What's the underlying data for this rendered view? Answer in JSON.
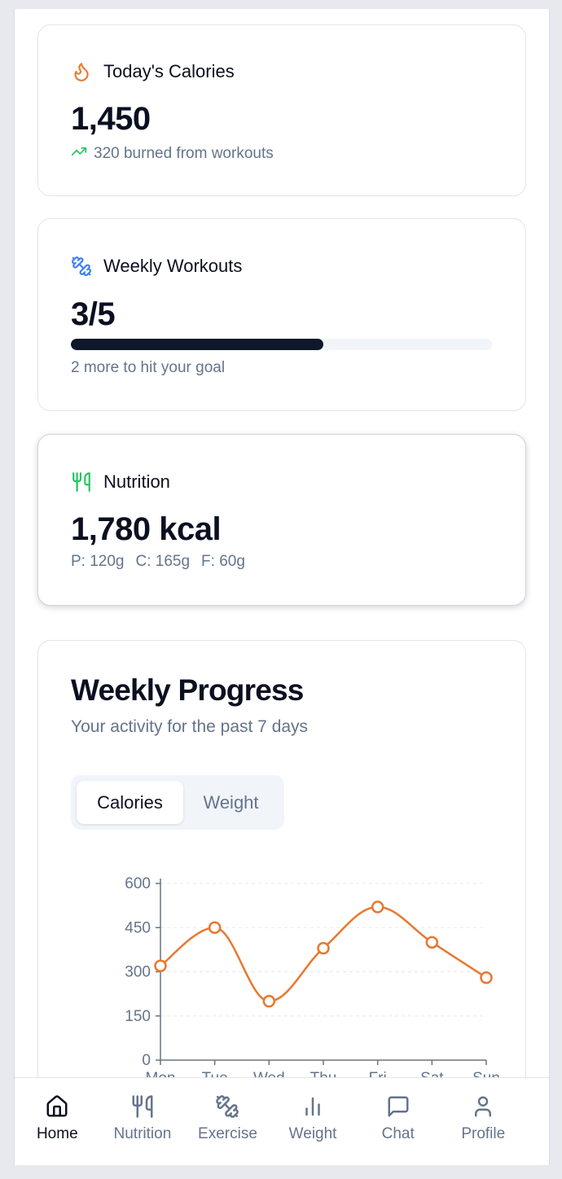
{
  "cards": {
    "calories": {
      "title": "Today's Calories",
      "value": "1,450",
      "subtext": "320 burned from workouts",
      "icon": "flame-icon",
      "icon_color": "#ea7a2e"
    },
    "workouts": {
      "title": "Weekly Workouts",
      "value": "3/5",
      "subtext": "2 more to hit your goal",
      "progress": 0.6,
      "icon": "dumbbell-icon",
      "icon_color": "#3b82f6"
    },
    "nutrition": {
      "title": "Nutrition",
      "value": "1,780 kcal",
      "macros": {
        "protein": "P: 120g",
        "carbs": "C: 165g",
        "fat": "F: 60g"
      },
      "icon": "utensils-icon",
      "icon_color": "#22c55e"
    }
  },
  "progress": {
    "title": "Weekly Progress",
    "subtitle": "Your activity for the past 7 days",
    "tabs": [
      "Calories",
      "Weight"
    ],
    "active_tab": "Calories"
  },
  "chart_data": {
    "type": "line",
    "categories": [
      "Mon",
      "Tue",
      "Wed",
      "Thu",
      "Fri",
      "Sat",
      "Sun"
    ],
    "values": [
      320,
      450,
      200,
      380,
      520,
      400,
      280
    ],
    "ylim": [
      0,
      600
    ],
    "yticks": [
      "0",
      "150",
      "300",
      "450",
      "600"
    ],
    "ytick_values": [
      0,
      150,
      300,
      450,
      600
    ],
    "grid": "horizontal dashed",
    "color": "#e8782f"
  },
  "nav": {
    "items": [
      {
        "label": "Home",
        "icon": "home-icon",
        "active": true
      },
      {
        "label": "Nutrition",
        "icon": "utensils-icon",
        "active": false
      },
      {
        "label": "Exercise",
        "icon": "dumbbell-icon",
        "active": false
      },
      {
        "label": "Weight",
        "icon": "bar-chart-icon",
        "active": false
      },
      {
        "label": "Chat",
        "icon": "message-icon",
        "active": false
      },
      {
        "label": "Profile",
        "icon": "user-icon",
        "active": false
      }
    ]
  },
  "colors": {
    "text_primary": "#0b1020",
    "text_muted": "#64748b",
    "trend_green": "#22c55e"
  }
}
